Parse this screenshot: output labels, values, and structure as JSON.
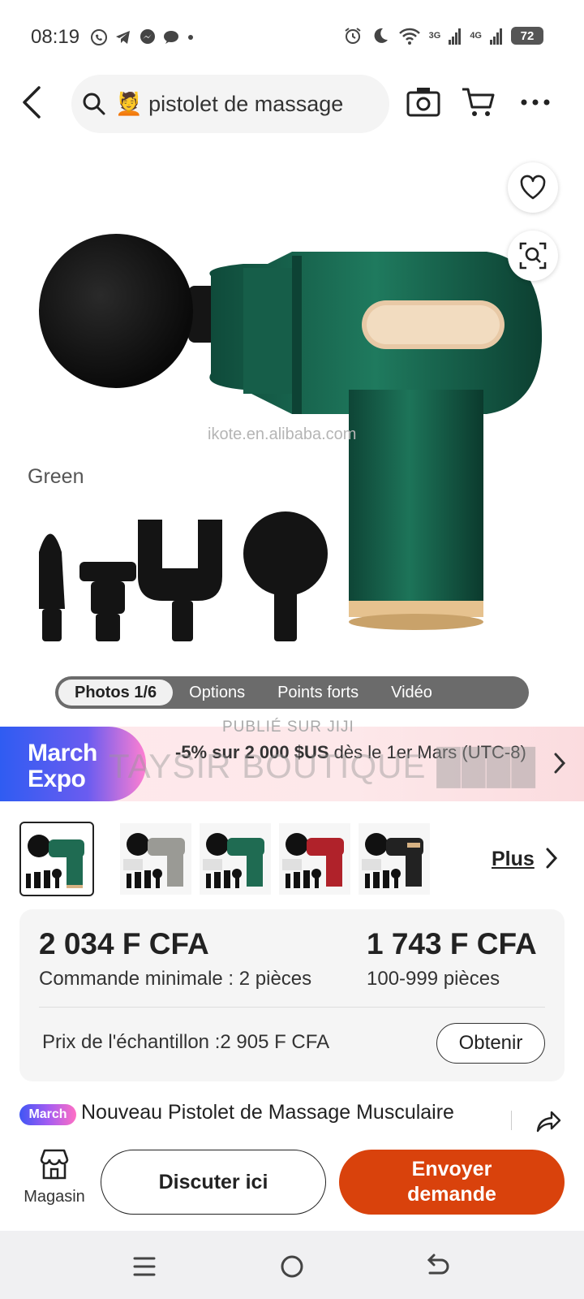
{
  "status_bar": {
    "time": "08:19",
    "network_3g": "3G",
    "network_4g": "4G",
    "battery": "72"
  },
  "search": {
    "emoji": "💆",
    "query": "pistolet de massage"
  },
  "gallery": {
    "watermark": "ikote.en.alibaba.com",
    "color_label": "Green",
    "tabs": [
      {
        "label": "Photos 1/6"
      },
      {
        "label": "Options"
      },
      {
        "label": "Points forts"
      },
      {
        "label": "Vidéo"
      }
    ]
  },
  "promo": {
    "brand_line1": "March",
    "brand_line2": "Expo",
    "offer_bold": "-5% sur 2 000 $US",
    "offer_rest": " dès le 1er Mars (UTC-8)"
  },
  "overlay": {
    "published": "PUBLIÉ SUR JIJI",
    "shop": "TAYSIR BOUTIQUE ████"
  },
  "variants": {
    "more_label": "Plus",
    "items": [
      {
        "color": "green"
      },
      {
        "color": "grey"
      },
      {
        "color": "teal"
      },
      {
        "color": "red"
      },
      {
        "color": "black"
      }
    ]
  },
  "pricing": {
    "price_min_order": "2 034 F CFA",
    "min_order_note": "Commande minimale : 2 pièces",
    "price_bulk": "1 743 F CFA",
    "bulk_note": "100-999 pièces",
    "sample_price": "Prix de l'échantillon :2 905 F CFA",
    "obtain_label": "Obtenir"
  },
  "product": {
    "badge": "March",
    "title": "Nouveau Pistolet de Massage Musculaire"
  },
  "actions": {
    "store_label": "Magasin",
    "chat_label": "Discuter ici",
    "send_line1": "Envoyer",
    "send_line2": "demande"
  },
  "colors": {
    "accent_orange": "#d9420c",
    "product_green": "#1f6b52"
  }
}
